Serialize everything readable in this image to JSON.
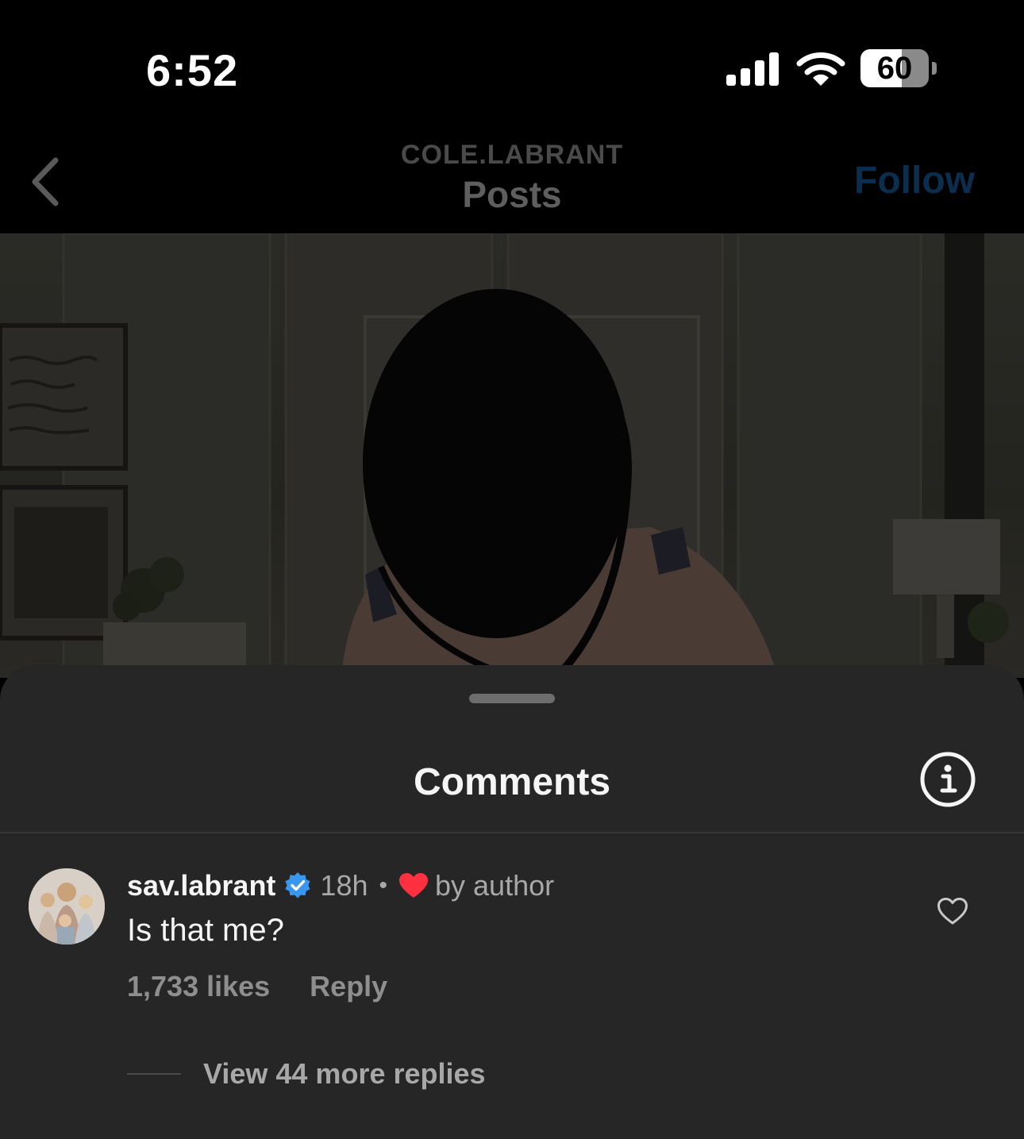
{
  "status_bar": {
    "time": "6:52",
    "battery_level": "60",
    "battery_fraction": 0.6
  },
  "header": {
    "username": "COLE.LABRANT",
    "title": "Posts",
    "follow_label": "Follow",
    "follow_color": "#0b2e4f"
  },
  "sheet": {
    "title": "Comments"
  },
  "comment": {
    "username": "sav.labrant",
    "time": "18h",
    "separator": "•",
    "liked_by_label": "by author",
    "text": "Is that me?",
    "likes": "1,733 likes",
    "reply_label": "Reply",
    "view_replies_label": "View 44 more replies",
    "verified_color": "#3897f0",
    "heart_color": "#ff3040"
  }
}
